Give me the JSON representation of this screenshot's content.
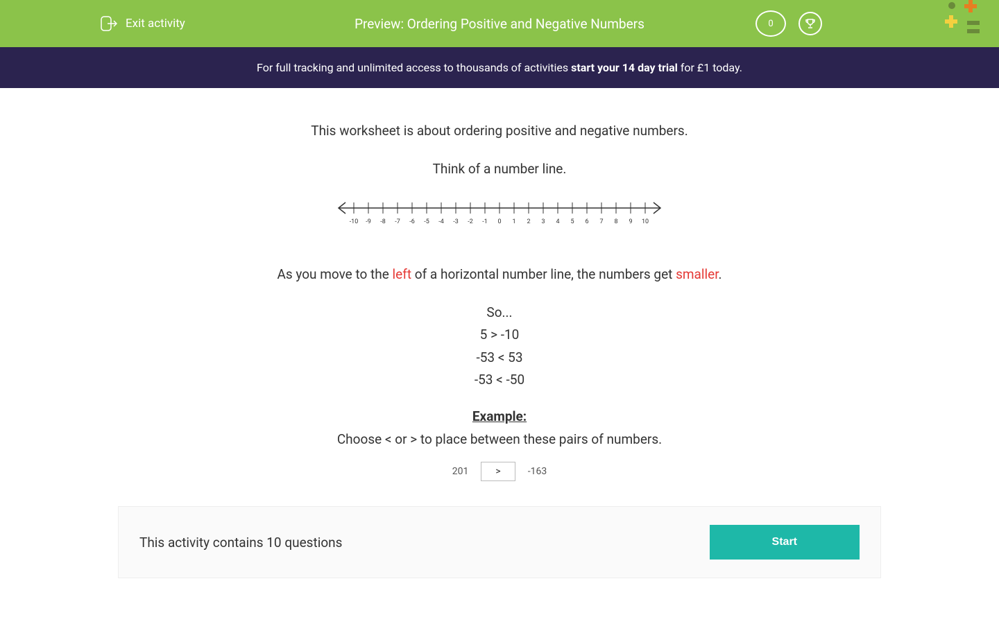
{
  "header": {
    "exit_label": "Exit activity",
    "title": "Preview: Ordering Positive and Negative Numbers",
    "score": "0"
  },
  "banner": {
    "prefix": "For full tracking and unlimited access to thousands of activities ",
    "bold": "start your 14 day trial",
    "suffix": " for £1 today."
  },
  "content": {
    "intro": "This worksheet is about ordering positive and negative numbers.",
    "think": "Think of a number line.",
    "numberline_labels": [
      "-10",
      "-9",
      "-8",
      "-7",
      "-6",
      "-5",
      "-4",
      "-3",
      "-2",
      "-1",
      "0",
      "1",
      "2",
      "3",
      "4",
      "5",
      "6",
      "7",
      "8",
      "9",
      "10"
    ],
    "move_prefix": "As you move to the ",
    "move_left": "left",
    "move_mid": " of a horizontal number line, the numbers get ",
    "move_smaller": "smaller",
    "move_suffix": ".",
    "so": "So...",
    "ex1": "5 > -10",
    "ex2": "-53 < 53",
    "ex3": "-53 < -50",
    "example_heading": "Example:",
    "example_instruction": "Choose < or > to place between these pairs of numbers.",
    "pair_left": "201",
    "pair_op": ">",
    "pair_right": "-163"
  },
  "footer": {
    "text": "This activity contains 10 questions",
    "start": "Start"
  }
}
